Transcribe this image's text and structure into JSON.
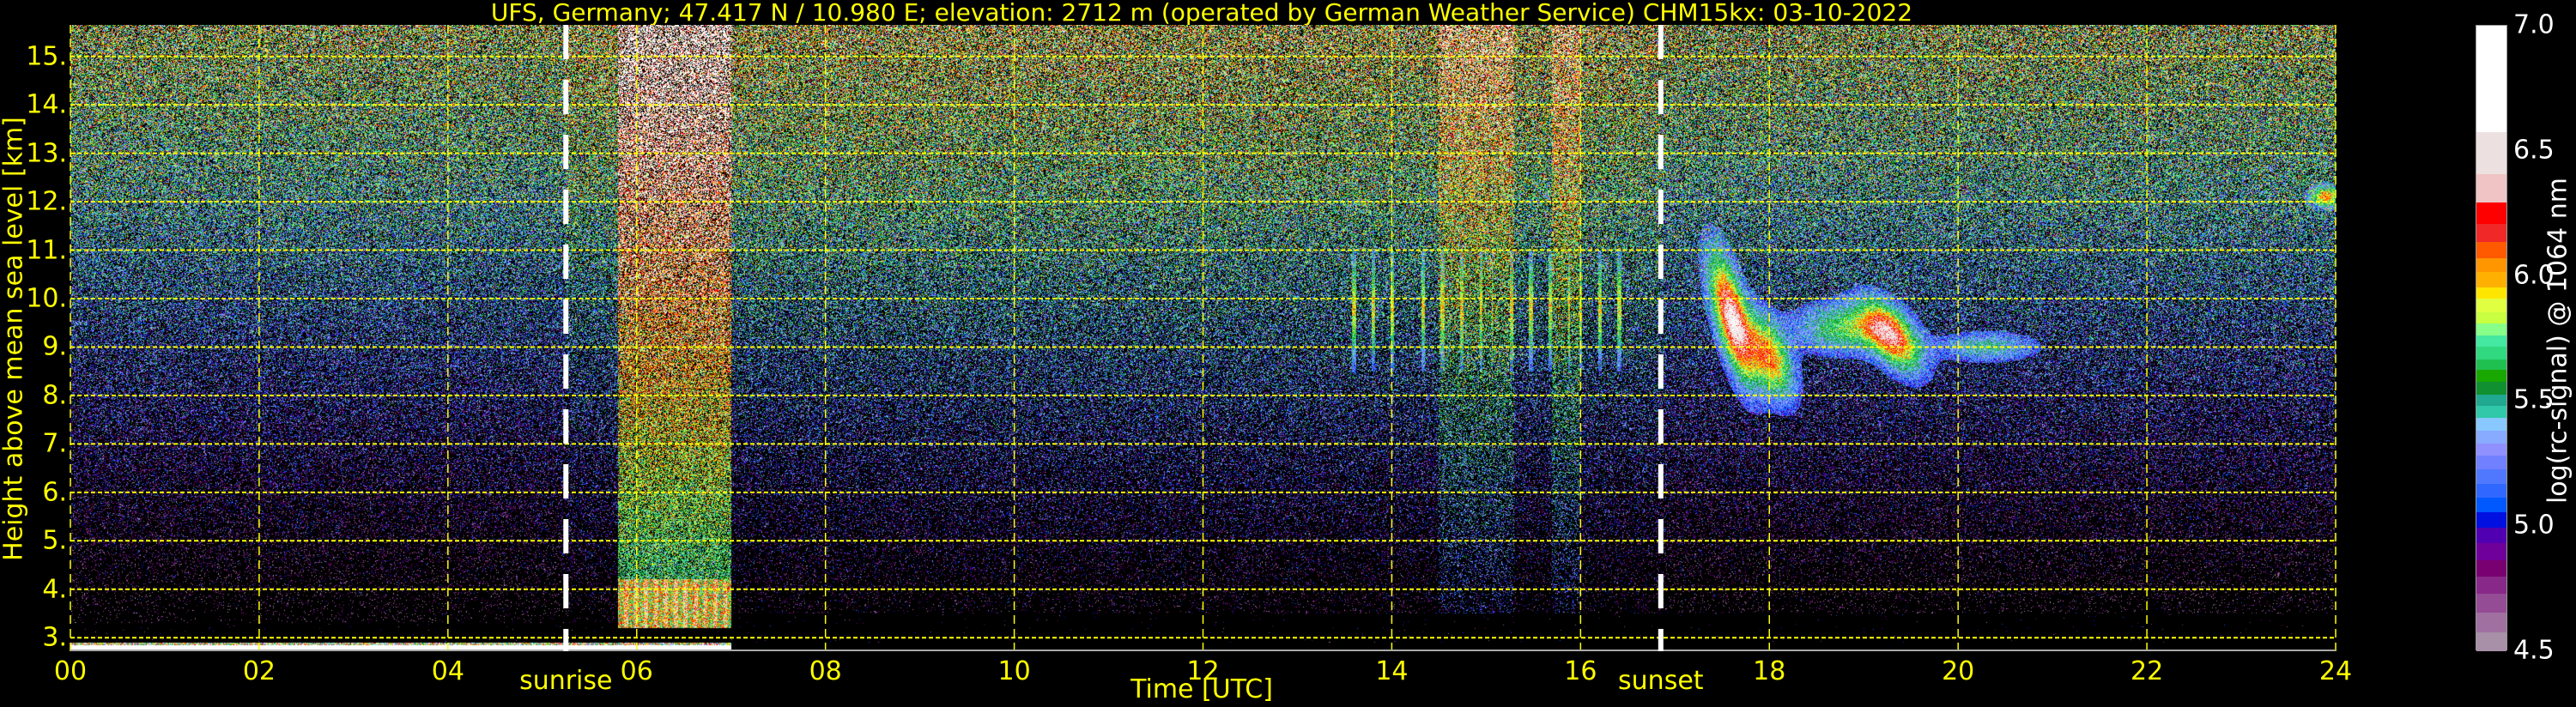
{
  "title": "UFS, Germany; 47.417 N / 10.980 E; elevation: 2712 m  (operated by German Weather Service)    CHM15kx: 03-10-2022",
  "chart_data": {
    "type": "heatmap",
    "title": "UFS, Germany; 47.417 N / 10.980 E; elevation: 2712 m  (operated by German Weather Service)    CHM15kx: 03-10-2022",
    "xlabel": "Time [UTC]",
    "ylabel": "Height above mean sea level [km]",
    "xlim": [
      0,
      24
    ],
    "ylim": [
      2.72,
      15.65
    ],
    "xticks": [
      0,
      2,
      4,
      6,
      8,
      10,
      12,
      14,
      16,
      18,
      20,
      22,
      24
    ],
    "xtick_labels": [
      "00",
      "02",
      "04",
      "06",
      "08",
      "10",
      "12",
      "14",
      "16",
      "18",
      "20",
      "22",
      "24"
    ],
    "yticks": [
      3,
      4,
      5,
      6,
      7,
      8,
      9,
      10,
      11,
      12,
      13,
      14,
      15
    ],
    "ytick_labels": [
      "3.",
      "4.",
      "5.",
      "6.",
      "7.",
      "8.",
      "9.",
      "10.",
      "11.",
      "12.",
      "13.",
      "14.",
      "15."
    ],
    "grid": true,
    "grid_color": "#ffff00",
    "annotations": [
      {
        "label": "sunrise",
        "time": 5.25,
        "line_color": "#ffffff"
      },
      {
        "label": "sunset",
        "time": 16.85,
        "line_color": "#ffffff"
      }
    ],
    "colorbar": {
      "label": "log(rc-signal) @ 1064 nm",
      "range": [
        4.5,
        7.0
      ],
      "ticks": [
        4.5,
        5.0,
        5.5,
        6.0,
        6.5,
        7.0
      ],
      "tick_labels": [
        "4.5",
        "5.0",
        "5.5",
        "6.0",
        "6.5",
        "7.0"
      ],
      "boundaries": [
        4.5,
        4.577,
        4.655,
        4.731,
        4.799,
        4.866,
        4.934,
        4.997,
        5.057,
        5.114,
        5.172,
        5.228,
        5.282,
        5.33,
        5.384,
        5.433,
        5.482,
        5.527,
        5.577,
        5.626,
        5.669,
        5.718,
        5.764,
        5.811,
        5.858,
        5.91,
        5.957,
        6.017,
        6.071,
        6.139,
        6.211,
        6.294,
        6.408,
        6.577,
        7.0
      ],
      "colors": [
        "#a890a8",
        "#a070a0",
        "#944c94",
        "#882888",
        "#780070",
        "#70009a",
        "#5000b0",
        "#0010e0",
        "#0058ff",
        "#3068ff",
        "#5078ff",
        "#7080ff",
        "#9090ff",
        "#88aaff",
        "#88c8ff",
        "#30c8a8",
        "#20a890",
        "#109030",
        "#18a800",
        "#20c050",
        "#30d880",
        "#44e8a0",
        "#88ff88",
        "#c8ff40",
        "#e0ff40",
        "#ffe600",
        "#ffb000",
        "#ff9600",
        "#ff5a00",
        "#f02828",
        "#ff0000",
        "#f0c4c4",
        "#ece0e0",
        "#ffffff"
      ]
    },
    "features": [
      {
        "name": "ground-signal",
        "t": [
          0,
          7.0
        ],
        "h": [
          2.72,
          2.9
        ],
        "value": 7.0
      },
      {
        "name": "boundary-layer",
        "t": [
          5.8,
          7.0
        ],
        "h": [
          3.2,
          4.2
        ],
        "value": 5.9
      },
      {
        "name": "solar-background",
        "t": [
          5.8,
          7.0
        ],
        "h": [
          3.5,
          15.65
        ],
        "value": 6.5
      },
      {
        "name": "cirrus-streaks",
        "t": [
          13.5,
          16.5
        ],
        "h": [
          8.5,
          11.0
        ],
        "value": 6.6
      },
      {
        "name": "cirrus-cloud-1",
        "t": [
          17.3,
          18.4
        ],
        "h": [
          7.9,
          10.9
        ],
        "value": 6.5
      },
      {
        "name": "cirrus-cloud-2",
        "t": [
          18.2,
          19.8
        ],
        "h": [
          8.2,
          10.2
        ],
        "value": 6.2
      },
      {
        "name": "cirrus-cloud-3",
        "t": [
          19.8,
          20.8
        ],
        "h": [
          8.6,
          9.3
        ],
        "value": 5.8
      },
      {
        "name": "high-cloud",
        "t": [
          23.7,
          24
        ],
        "h": [
          11.9,
          12.3
        ],
        "value": 6.1
      }
    ]
  }
}
